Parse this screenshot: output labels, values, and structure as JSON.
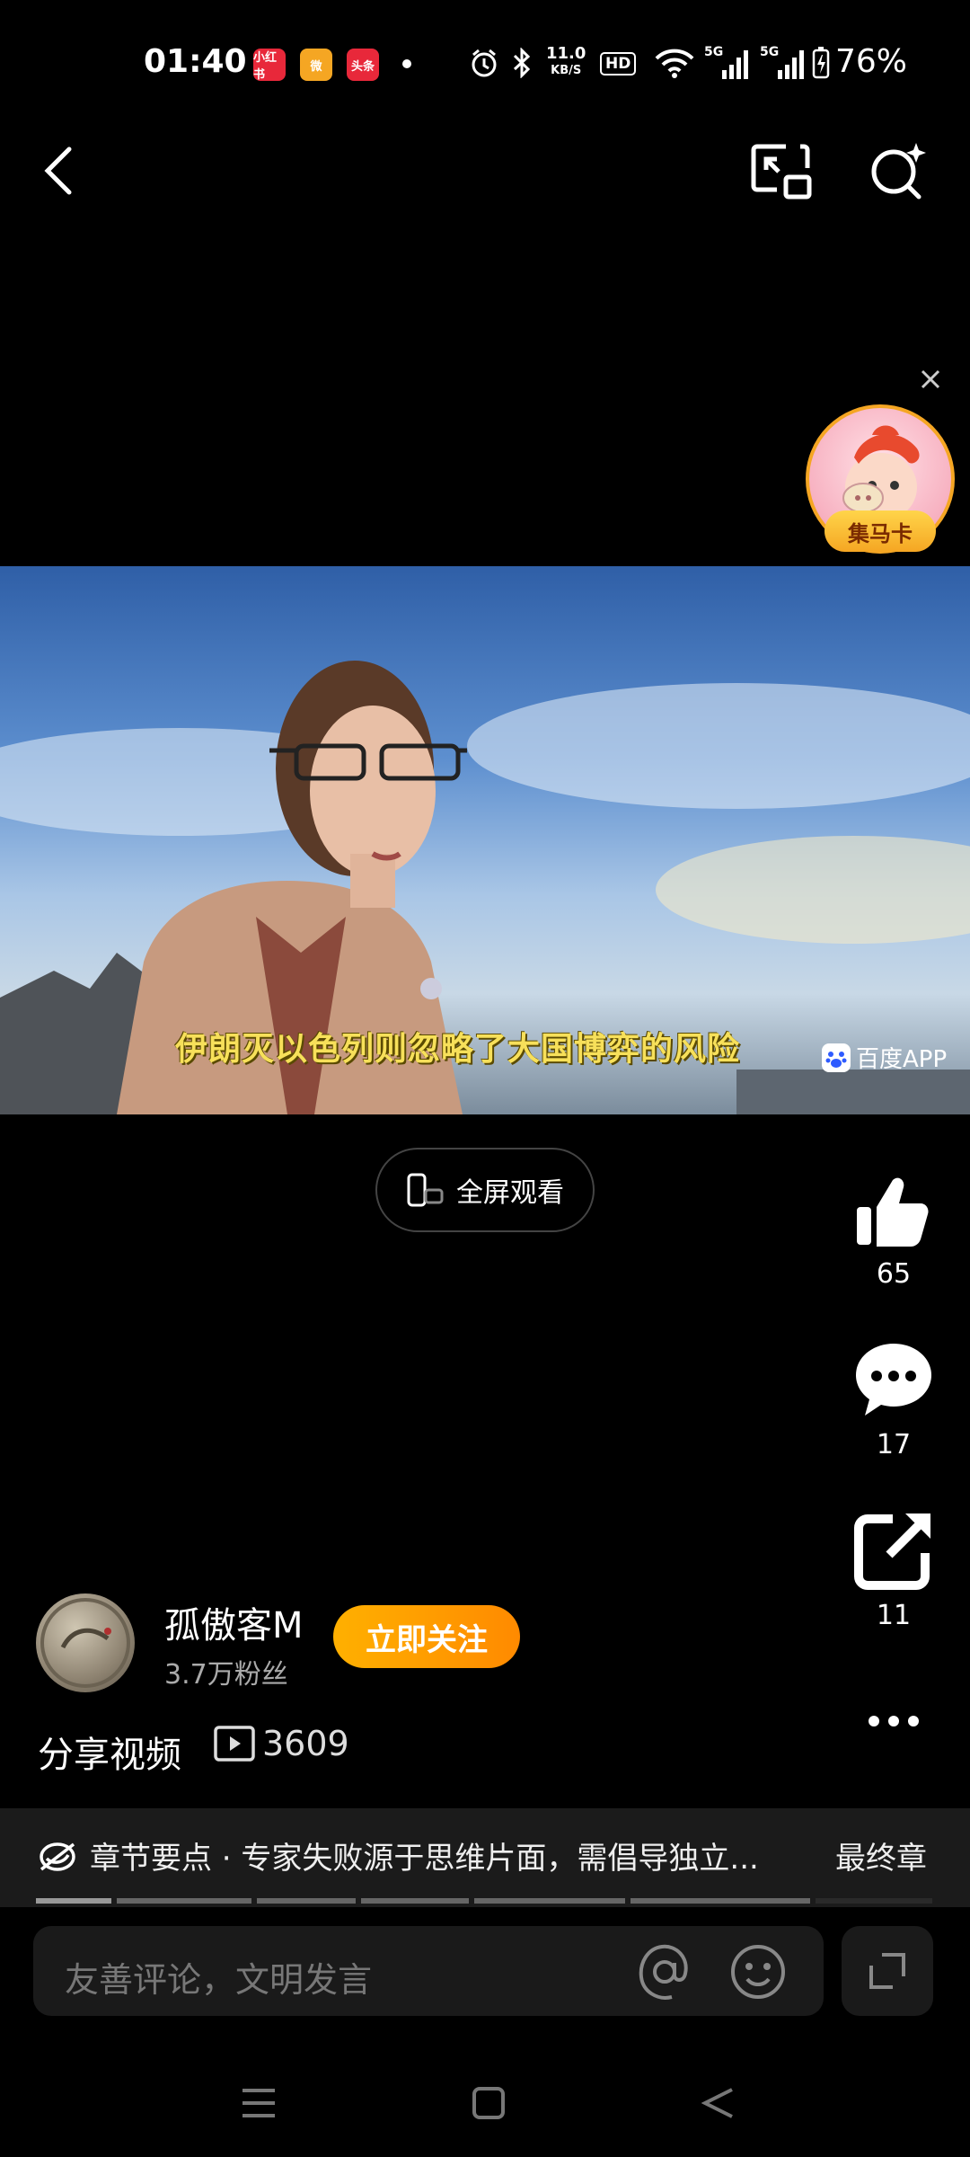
{
  "status_bar": {
    "time": "01:40",
    "apps": [
      {
        "name": "xiaohongshu-icon",
        "label": "小红书",
        "color": "#e8283a"
      },
      {
        "name": "weibo-icon",
        "label": "微",
        "color": "#f5a623"
      },
      {
        "name": "toutiao-icon",
        "label": "头条",
        "color": "#e8283a"
      }
    ],
    "net_speed_value": "11.0",
    "net_speed_unit": "KB/S",
    "hd_label": "HD",
    "sig1_label": "5G",
    "sig2_label": "5G",
    "battery": "76%"
  },
  "promo": {
    "label": "集马卡"
  },
  "video": {
    "subtitle": "伊朗灭以色列则忽略了大国博弈的风险",
    "watermark": "百度APP"
  },
  "fullscreen_label": "全屏观看",
  "actions": {
    "likes": "65",
    "comments": "17",
    "shares": "11"
  },
  "author": {
    "name": "孤傲客M",
    "fans": "3.7万粉丝",
    "follow_label": "立即关注"
  },
  "post": {
    "title": "分享视频",
    "plays": "3609"
  },
  "chapter": {
    "text": "章节要点 · 专家失败源于思维片面，需倡导独立...",
    "end_label": "最终章"
  },
  "comment": {
    "placeholder": "友善评论，文明发言"
  },
  "colors": {
    "accent": "#ff9a00",
    "background": "#000000"
  }
}
